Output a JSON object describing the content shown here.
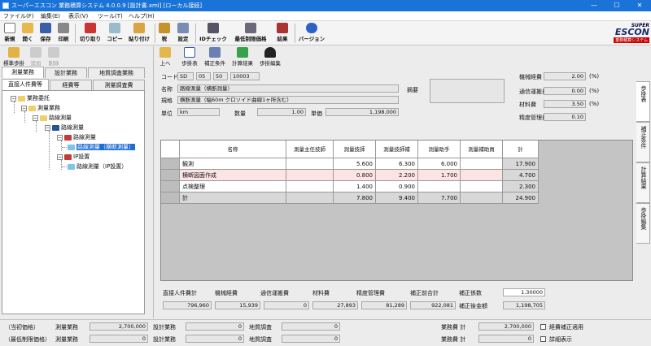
{
  "window": {
    "title": "スーパーエスコン 業務積算システム 4.0.0.9 [設計書.xml] [ローカル接続]",
    "minimize": "—",
    "maximize": "☐",
    "close": "✕"
  },
  "menu": [
    "ファイル(F)",
    "編集(E)",
    "表示(V)",
    "ツール(T)",
    "ヘルプ(H)"
  ],
  "toolbar": [
    {
      "label": "新規",
      "icon": "new-file-icon"
    },
    {
      "label": "開く",
      "icon": "open-folder-icon"
    },
    {
      "label": "保存",
      "icon": "save-icon"
    },
    {
      "label": "印刷",
      "icon": "print-icon"
    },
    {
      "label": "切り取り",
      "icon": "cut-icon"
    },
    {
      "label": "コピー",
      "icon": "copy-icon"
    },
    {
      "label": "貼り付け",
      "icon": "paste-icon"
    },
    {
      "label": "税",
      "icon": "tax-icon"
    },
    {
      "label": "設定",
      "icon": "settings-icon"
    },
    {
      "label": "IDチェック",
      "icon": "id-check-icon"
    },
    {
      "label": "最低制限価格",
      "icon": "min-price-icon"
    },
    {
      "label": "結果",
      "icon": "result-icon"
    },
    {
      "label": "バージョン",
      "icon": "help-icon"
    }
  ],
  "logo": {
    "line1": "SUPER",
    "line2": "ESCON",
    "line3": "業務積算システム"
  },
  "left_tools": [
    {
      "label": "標準歩掛",
      "icon": "standard-rate-icon",
      "enabled": true
    },
    {
      "label": "追加",
      "icon": "add-icon",
      "enabled": false
    },
    {
      "label": "削除",
      "icon": "delete-icon",
      "enabled": false
    }
  ],
  "left_tabs_top": [
    "測量業務",
    "設計業務",
    "地質調査業務"
  ],
  "left_tabs_bottom": [
    "直接人件費等",
    "経費等",
    "測量調査費"
  ],
  "tree": [
    {
      "label": "業務委託",
      "box": "−"
    },
    {
      "label": "測量業務",
      "box": "−"
    },
    {
      "label": "路線測量",
      "box": "−"
    },
    {
      "label": "路線測量",
      "box": "−"
    },
    {
      "label": "路線測量",
      "box": "−"
    },
    {
      "label": "路線測量（横断測量）",
      "box": ""
    },
    {
      "label": "IP設置",
      "box": "−"
    },
    {
      "label": "路線測量（IP設置）",
      "box": ""
    }
  ],
  "right_tools": [
    {
      "label": "上へ",
      "icon": "up-icon"
    },
    {
      "label": "歩掛表",
      "icon": "rate-table-icon"
    },
    {
      "label": "補正条件",
      "icon": "correction-icon"
    },
    {
      "label": "計算結果",
      "icon": "calc-result-icon"
    },
    {
      "label": "歩掛編集",
      "icon": "user-edit-icon"
    }
  ],
  "form": {
    "code_label": "コード",
    "code": [
      "SD",
      "05",
      "50",
      "10003"
    ],
    "name_label": "名称",
    "name": "路線測量（横断測量）",
    "spec_label": "規格",
    "spec": "横断測量（幅60m クロソイド曲線1ヶ所含む）",
    "unit_label": "単位",
    "unit": "km",
    "qty_label": "数量",
    "qty": "1.00",
    "price_label": "単価",
    "price": "1,198,000",
    "summary_label": "摘要",
    "rates": [
      {
        "label": "機械経費",
        "value": "2.00",
        "unit": "(%)"
      },
      {
        "label": "通信運搬費",
        "value": "0.00",
        "unit": "(%)"
      },
      {
        "label": "材料費",
        "value": "3.50",
        "unit": "(%)"
      },
      {
        "label": "精度管理費",
        "value": "0.10",
        "unit": ""
      }
    ]
  },
  "side_tabs": [
    "歩掛表",
    "補正条件",
    "計算結果",
    "歩掛編集"
  ],
  "grid": {
    "headers": [
      "名称",
      "測量主任技師",
      "測量技師",
      "測量技師補",
      "測量助手",
      "測量補助員",
      "計"
    ],
    "rows": [
      {
        "name": "観測",
        "cells": [
          "",
          "5.600",
          "6.300",
          "6.000",
          "",
          "17.900"
        ]
      },
      {
        "name": "横断図面作成",
        "cells": [
          "",
          "0.800",
          "2.200",
          "1.700",
          "",
          "4.700"
        ]
      },
      {
        "name": "点検整理",
        "cells": [
          "",
          "1.400",
          "0.900",
          "",
          "",
          "2.300"
        ]
      },
      {
        "name": "計",
        "cells": [
          "",
          "7.800",
          "9.400",
          "7.700",
          "",
          "24.900"
        ]
      }
    ]
  },
  "summary": {
    "labels": [
      "直接人件費計",
      "機械経費",
      "通信運搬費",
      "材料費",
      "精度管理費",
      "補正前合計"
    ],
    "values": [
      "796,960",
      "15,939",
      "0",
      "27,893",
      "81,289",
      "922,081"
    ],
    "coef_label": "補正係数",
    "coef": "1.30000",
    "after_label": "補正後金額",
    "after": "1,198,705"
  },
  "footer": {
    "row1_label": "（当初価格）",
    "row2_label": "（最低制限価格）",
    "cols": [
      {
        "label": "測量業務",
        "v1": "2,700,000",
        "v2": "0"
      },
      {
        "label": "設計業務",
        "v1": "0",
        "v2": "0"
      },
      {
        "label": "地質調査",
        "v1": "0",
        "v2": "0"
      }
    ],
    "total_label": "業務費 計",
    "total1": "2,700,000",
    "total2": "0",
    "check1": "経費補正適用",
    "check2": "詳細表示"
  },
  "colors": {
    "titlebar": "#1a73d6",
    "selection": "#1e6fd4",
    "highlight_row": "#fde4e4"
  }
}
